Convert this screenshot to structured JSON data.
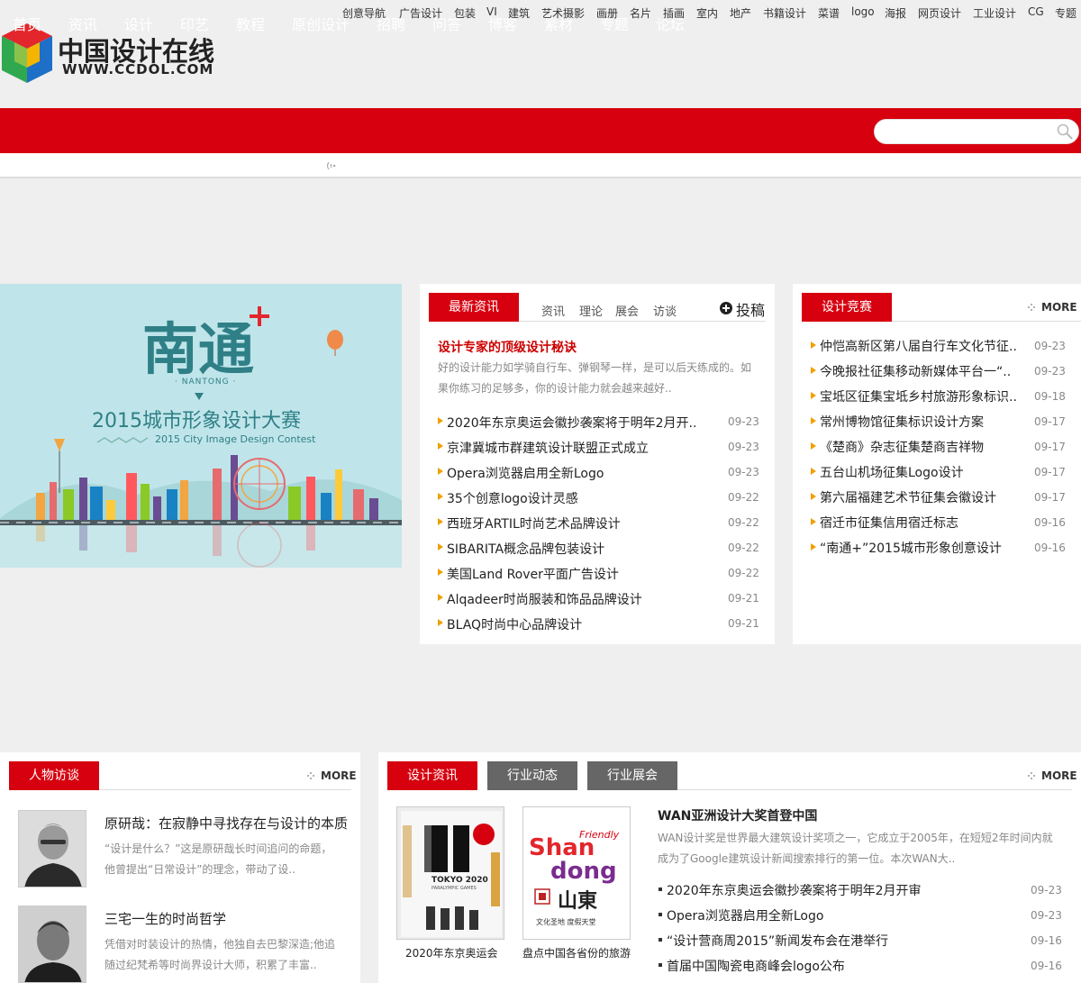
{
  "header": {
    "logo_title": "中国设计在线",
    "logo_url": "WWW.CCDOL.COM"
  },
  "nav": {
    "items": [
      "首页",
      "资讯",
      "设计",
      "印艺",
      "教程",
      "原创设计",
      "招聘",
      "问答",
      "博客",
      "素材",
      "专题",
      "论坛"
    ],
    "search_placeholder": ""
  },
  "subnav": {
    "lead": "创意导航",
    "items": [
      "广告设计",
      "包装",
      "VI",
      "建筑",
      "艺术摄影",
      "画册",
      "名片",
      "插画",
      "室内",
      "地产",
      "书籍设计",
      "菜谱",
      "logo",
      "海报",
      "网页设计",
      "工业设计",
      "CG",
      "专题"
    ]
  },
  "banner": {
    "title": "南通",
    "sub": "· NANTONG ·",
    "cn": "2015城市形象设计大赛",
    "en": "2015 City Image Design Contest"
  },
  "latest": {
    "tab": "最新资讯",
    "subtabs": [
      "资讯",
      "理论",
      "展会",
      "访谈"
    ],
    "submit": "投稿",
    "headline": "设计专家的顶级设计秘诀",
    "summary": "好的设计能力如学骑自行车、弹钢琴一样，是可以后天练成的。如果你练习的足够多，你的设计能力就会越来越好..",
    "items": [
      {
        "title": "2020年东京奥运会徽抄袭案将于明年2月开..",
        "date": "09-23"
      },
      {
        "title": "京津冀城市群建筑设计联盟正式成立",
        "date": "09-23"
      },
      {
        "title": "Opera浏览器启用全新Logo",
        "date": "09-23"
      },
      {
        "title": "35个创意logo设计灵感",
        "date": "09-22"
      },
      {
        "title": "西班牙ARTIL时尚艺术品牌设计",
        "date": "09-22"
      },
      {
        "title": "SIBARITA概念品牌包装设计",
        "date": "09-22"
      },
      {
        "title": "美国Land Rover平面广告设计",
        "date": "09-22"
      },
      {
        "title": "Alqadeer时尚服装和饰品品牌设计",
        "date": "09-21"
      },
      {
        "title": "BLAQ时尚中心品牌设计",
        "date": "09-21"
      }
    ]
  },
  "contest": {
    "tab": "设计竞赛",
    "more": "MORE",
    "items": [
      {
        "title": "仲恺高新区第八届自行车文化节征..",
        "date": "09-23"
      },
      {
        "title": "今晚报社征集移动新媒体平台一“..",
        "date": "09-23"
      },
      {
        "title": "宝坻区征集宝坻乡村旅游形象标识..",
        "date": "09-18"
      },
      {
        "title": "常州博物馆征集标识设计方案",
        "date": "09-17"
      },
      {
        "title": "《楚商》杂志征集楚商吉祥物",
        "date": "09-17"
      },
      {
        "title": "五台山机场征集Logo设计",
        "date": "09-17"
      },
      {
        "title": "第六届福建艺术节征集会徽设计",
        "date": "09-17"
      },
      {
        "title": "宿迁市征集信用宿迁标志",
        "date": "09-16"
      },
      {
        "title": "“南通+”2015城市形象创意设计",
        "date": "09-16"
      }
    ]
  },
  "people": {
    "tab": "人物访谈",
    "more": "MORE",
    "items": [
      {
        "title": "原研哉：在寂静中寻找存在与设计的本质",
        "summary": "“设计是什么？”这是原研哉长时间追问的命题，他曾提出“日常设计”的理念，带动了设.."
      },
      {
        "title": "三宅一生的时尚哲学",
        "summary": "凭借对时装设计的热情，他独自去巴黎深造;他追随过纪梵希等时尚界设计大师，积累了丰富.."
      }
    ]
  },
  "design_news": {
    "tabs": [
      "设计资讯",
      "行业动态",
      "行业展会"
    ],
    "more": "MORE",
    "thumbs": [
      {
        "caption": "2020年东京奥运会",
        "logo": "TOKYO 2020",
        "logo_sub": "PARALYMPIC GAMES"
      },
      {
        "caption": "盘点中国各省份的旅游",
        "logo_top": "Friendly",
        "logo_a": "Shan",
        "logo_b": "dong",
        "logo_cn": "山東",
        "logo_foot": "文化圣地  度假天堂"
      }
    ],
    "headline": "WAN亚洲设计大奖首登中国",
    "summary": "WAN设计奖是世界最大建筑设计奖项之一，它成立于2005年，在短短2年时间内就成为了Google建筑设计新闻搜索排行的第一位。本次WAN大..",
    "items": [
      {
        "title": "2020年东京奥运会徽抄袭案将于明年2月开审",
        "date": "09-23"
      },
      {
        "title": "Opera浏览器启用全新Logo",
        "date": "09-23"
      },
      {
        "title": "“设计营商周2015”新闻发布会在港举行",
        "date": "09-16"
      },
      {
        "title": "首届中国陶瓷电商峰会logo公布",
        "date": "09-16"
      }
    ]
  },
  "colors": {
    "brand_red": "#d7000f",
    "tab_gray": "#666666"
  }
}
